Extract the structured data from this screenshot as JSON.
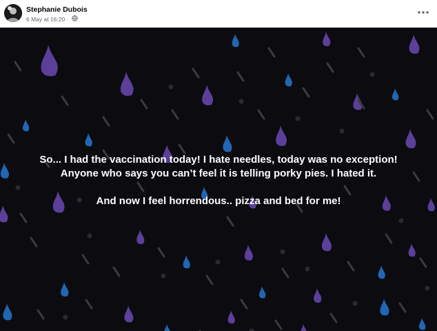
{
  "post": {
    "author": "Stephanie Dubois",
    "date": "6 May at 16:20",
    "separator": "·",
    "privacy_icon": "globe-icon",
    "menu_icon": "more-options-icon",
    "text_lines": [
      "So... I had the vaccination today! I hate needles, today was no exception!",
      "Anyone who says you can’t feel it is telling porky pies. I hated it.",
      "And now I feel horrendous.. pizza and bed for me!"
    ],
    "background_theme": "raindrops",
    "colors": {
      "background": "#0b0b10",
      "drop_purple": "#5b3f99",
      "drop_blue": "#2166b3",
      "drop_gray": "#3a3a40",
      "text": "#ffffff"
    }
  }
}
